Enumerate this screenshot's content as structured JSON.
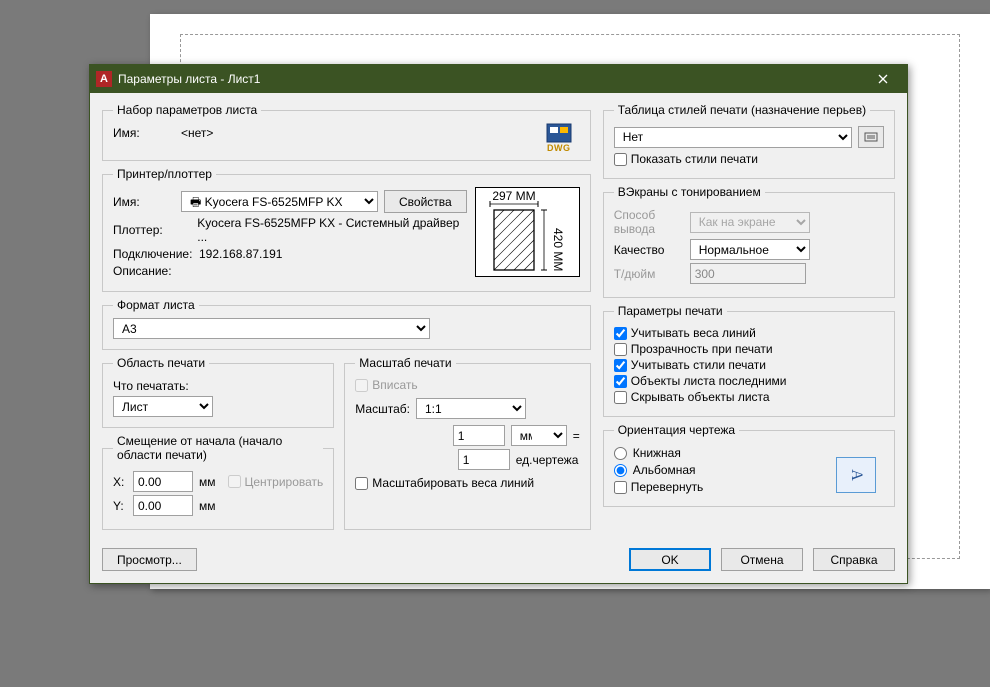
{
  "title": "Параметры листа - Лист1",
  "page_set": {
    "legend": "Набор параметров листа",
    "name_label": "Имя:",
    "name_value": "<нет>",
    "dwg_label": "DWG"
  },
  "printer": {
    "legend": "Принтер/плоттер",
    "name_label": "Имя:",
    "printer_value": "Kyocera FS-6525MFP KX",
    "props_btn": "Свойства",
    "plotter_label": "Плоттер:",
    "plotter_value": "Kyocera FS-6525MFP KX - Системный драйвер ...",
    "conn_label": "Подключение:",
    "conn_value": "192.168.87.191",
    "desc_label": "Описание:",
    "paper_w": "297 MM",
    "paper_h": "420 MM"
  },
  "format": {
    "legend": "Формат листа",
    "value": "A3"
  },
  "area": {
    "legend": "Область печати",
    "what_label": "Что печатать:",
    "value": "Лист"
  },
  "offset": {
    "legend": "Смещение от начала (начало области печати)",
    "x_label": "X:",
    "x_value": "0.00",
    "y_label": "Y:",
    "y_value": "0.00",
    "unit": "мм",
    "center_label": "Центрировать"
  },
  "scale": {
    "legend": "Масштаб печати",
    "fit_label": "Вписать",
    "scale_label": "Масштаб:",
    "scale_value": "1:1",
    "num_value": "1",
    "unit_value": "мм",
    "eq": "=",
    "den_value": "1",
    "den_unit": "ед.чертежа",
    "scale_lw_label": "Масштабировать веса линий"
  },
  "plotstyle": {
    "legend": "Таблица стилей печати (назначение перьев)",
    "value": "Нет",
    "show_label": "Показать стили печати"
  },
  "shade": {
    "legend": "ВЭкраны с тонированием",
    "mode_label": "Способ вывода",
    "mode_value": "Как на экране",
    "quality_label": "Качество",
    "quality_value": "Нормальное",
    "dpi_label": "Т/дюйм",
    "dpi_value": "300"
  },
  "opts": {
    "legend": "Параметры печати",
    "lw": "Учитывать веса линий",
    "trans": "Прозрачность при печати",
    "styles": "Учитывать стили печати",
    "last": "Объекты листа последними",
    "hide": "Скрывать объекты листа"
  },
  "orient": {
    "legend": "Ориентация чертежа",
    "portrait": "Книжная",
    "landscape": "Альбомная",
    "upside": "Перевернуть",
    "glyph": "A"
  },
  "footer": {
    "preview": "Просмотр...",
    "ok": "OK",
    "cancel": "Отмена",
    "help": "Справка"
  }
}
